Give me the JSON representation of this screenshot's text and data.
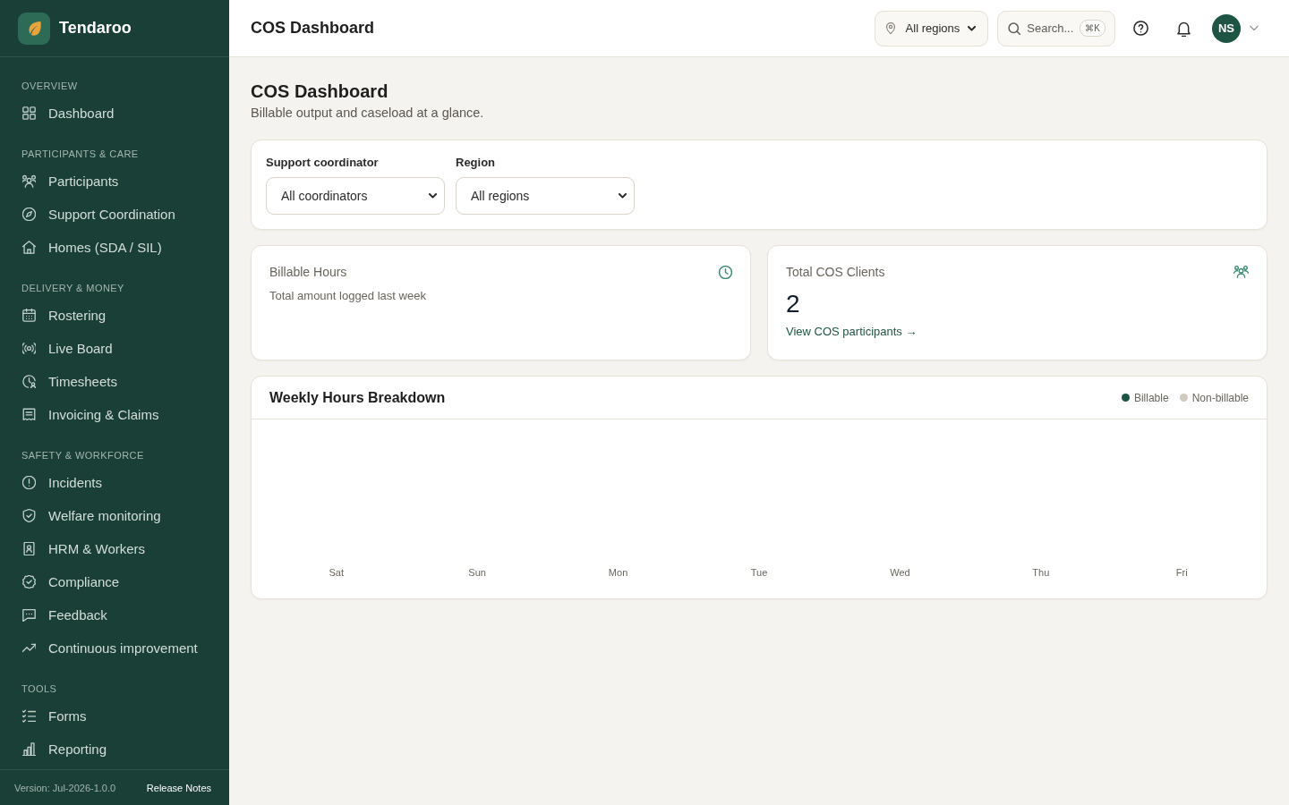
{
  "sidebar": {
    "brand": "Tendaroo",
    "sections": [
      {
        "heading": "OVERVIEW",
        "items": [
          {
            "label": "Dashboard",
            "selected": false
          }
        ]
      },
      {
        "heading": "PARTICIPANTS & CARE",
        "items": [
          {
            "label": "Participants",
            "selected": false
          },
          {
            "label": "Support Coordination",
            "selected": false
          },
          {
            "label": "Homes (SDA / SIL)",
            "selected": false
          }
        ]
      },
      {
        "heading": "DELIVERY & MONEY",
        "items": [
          {
            "label": "Rostering",
            "selected": false
          },
          {
            "label": "Live Board",
            "selected": false
          },
          {
            "label": "Timesheets",
            "selected": false
          },
          {
            "label": "Invoicing & Claims",
            "selected": false
          }
        ]
      },
      {
        "heading": "SAFETY & WORKFORCE",
        "items": [
          {
            "label": "Incidents",
            "selected": false
          },
          {
            "label": "Welfare monitoring",
            "selected": false
          },
          {
            "label": "HRM & Workers",
            "selected": false
          },
          {
            "label": "Compliance",
            "selected": false
          },
          {
            "label": "Feedback",
            "selected": false
          },
          {
            "label": "Continuous improvement",
            "selected": false
          }
        ]
      },
      {
        "heading": "TOOLS",
        "items": [
          {
            "label": "Forms",
            "selected": false
          },
          {
            "label": "Reporting",
            "selected": false
          }
        ]
      }
    ],
    "footer": {
      "version": "Version: Jul-2026-1.0.0",
      "link": "Release Notes"
    }
  },
  "topbar": {
    "title": "COS Dashboard",
    "region_picker": "All regions",
    "search": {
      "label": "Search...",
      "shortcut": "⌘K"
    },
    "avatar": "NS"
  },
  "main": {
    "heading": "COS Dashboard",
    "subheading": "Billable output and caseload at a glance.",
    "filters": [
      {
        "label": "Support coordinator",
        "value": "All coordinators"
      },
      {
        "label": "Region",
        "value": "All regions"
      }
    ],
    "stats": [
      {
        "title": "Billable Hours",
        "description": "Total amount logged last week"
      },
      {
        "title": "Total COS Clients",
        "value": "2",
        "link": "View COS participants →"
      }
    ],
    "weekly_hours": {
      "title": "Weekly Hours Breakdown",
      "legend": [
        {
          "label": "Billable",
          "color": "#1d5443"
        },
        {
          "label": "Non-billable",
          "color": "#d1cabe"
        }
      ],
      "days": [
        "Sat",
        "Sun",
        "Mon",
        "Tue",
        "Wed",
        "Thu",
        "Fri"
      ]
    }
  }
}
